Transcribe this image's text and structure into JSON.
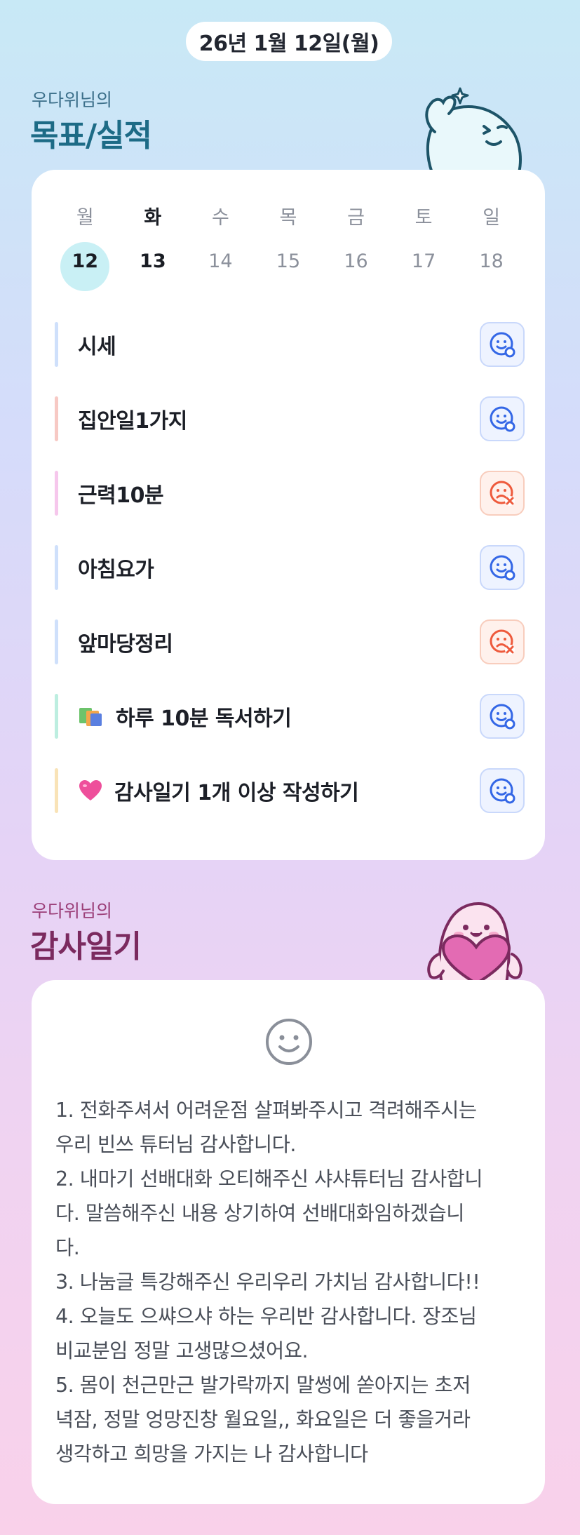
{
  "header": {
    "date": "26년 1월 12일(월)"
  },
  "goals_section": {
    "subtitle": "우다위님의",
    "title": "목표/실적"
  },
  "calendar": {
    "weekdays": [
      "월",
      "화",
      "수",
      "목",
      "금",
      "토",
      "일"
    ],
    "days": [
      "12",
      "13",
      "14",
      "15",
      "16",
      "17",
      "18"
    ],
    "selected_index": 0,
    "today_index": 1
  },
  "goals": [
    {
      "label": "시세",
      "emoji": "",
      "bar_color": "#cfe0fb",
      "status": "done"
    },
    {
      "label": "집안일1가지",
      "emoji": "",
      "bar_color": "#f7c9c4",
      "status": "done"
    },
    {
      "label": "근력10분",
      "emoji": "",
      "bar_color": "#f6c7ec",
      "status": "fail"
    },
    {
      "label": "아침요가",
      "emoji": "",
      "bar_color": "#cfe0fb",
      "status": "done"
    },
    {
      "label": "앞마당정리",
      "emoji": "",
      "bar_color": "#cfe0fb",
      "status": "fail"
    },
    {
      "label": "하루 10분 독서하기",
      "emoji": "books-icon",
      "bar_color": "#bdeee0",
      "status": "done"
    },
    {
      "label": "감사일기 1개 이상 작성하기",
      "emoji": "heart-icon",
      "bar_color": "#f9e3b7",
      "status": "done"
    }
  ],
  "gratitude_section": {
    "subtitle": "우다위님의",
    "title": "감사일기",
    "mood_icon": "smile-face-icon",
    "lines": [
      "1. 전화주셔서 어려운점 살펴봐주시고 격려해주시는",
      "우리 빈쓰 튜터님 감사합니다.",
      "2. 내마기 선배대화 오티해주신 샤샤튜터님 감사합니",
      "다. 말씀해주신 내용 상기하여 선배대화임하겠습니",
      "다.",
      "3. 나눔글 특강해주신 우리우리 가치님 감사합니다!!",
      "4. 오늘도 으쌰으샤 하는 우리반 감사합니다. 장조님",
      "비교분임 정말 고생많으셨어요.",
      "5. 몸이 천근만근 발가락까지 말썽에 쏟아지는 초저",
      "녁잠,  정말 엉망진창 월요일,, 화요일은 더 좋을거라",
      "생각하고 희망을 가지는 나 감사합니다"
    ]
  },
  "colors": {
    "done_icon": "#3467e6",
    "fail_icon": "#ee5a3c",
    "goals_title": "#1d6b86",
    "gratitude_title": "#7b2a5f"
  }
}
